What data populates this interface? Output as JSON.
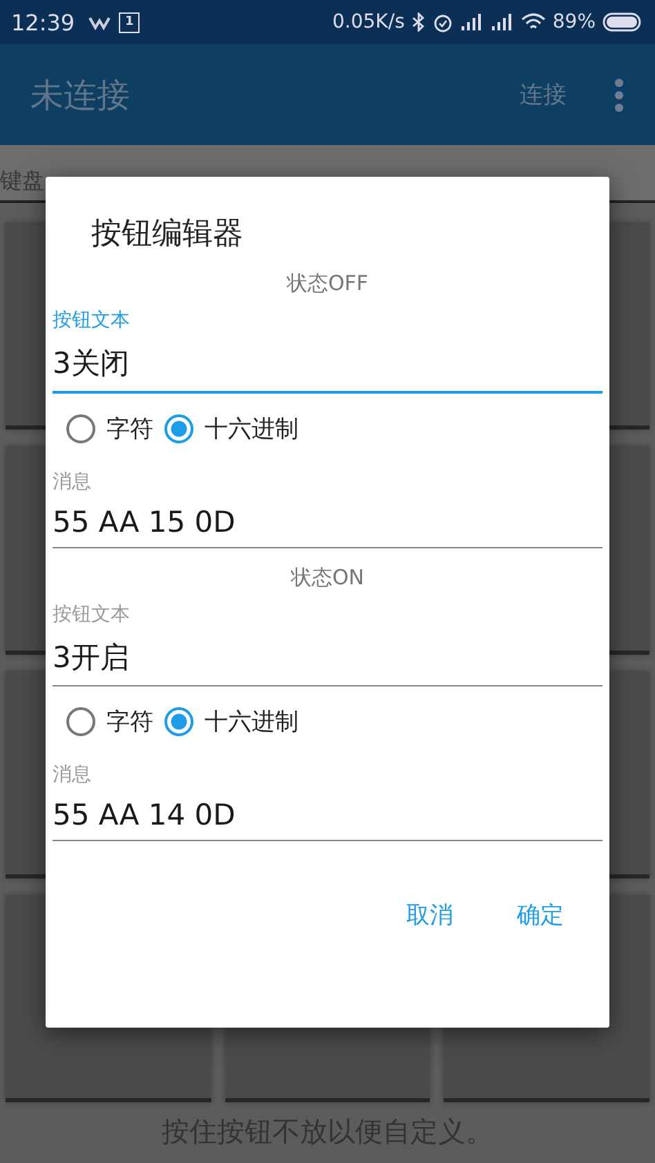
{
  "status_bar": {
    "time": "12:39",
    "calendar_day": "1",
    "network_speed": "0.05K/s",
    "battery": "89%"
  },
  "app_bar": {
    "title": "未连接",
    "action": "连接"
  },
  "tabs": [
    {
      "label": "键盘",
      "selected": false
    }
  ],
  "hint": "按住按钮不放以便自定义。",
  "dialog": {
    "title": "按钮编辑器",
    "sections": [
      {
        "heading": "状态OFF",
        "text_field": {
          "label": "按钮文本",
          "value": "3关闭",
          "focused": true
        },
        "encodings": [
          {
            "label": "字符",
            "selected": false
          },
          {
            "label": "十六进制",
            "selected": true
          }
        ],
        "message_field": {
          "label": "消息",
          "value": "55 AA 15 0D",
          "focused": false
        }
      },
      {
        "heading": "状态ON",
        "text_field": {
          "label": "按钮文本",
          "value": "3开启",
          "focused": false
        },
        "encodings": [
          {
            "label": "字符",
            "selected": false
          },
          {
            "label": "十六进制",
            "selected": true
          }
        ],
        "message_field": {
          "label": "消息",
          "value": "55 AA 14 0D",
          "focused": false
        }
      }
    ],
    "buttons": [
      "取消",
      "确定"
    ]
  }
}
